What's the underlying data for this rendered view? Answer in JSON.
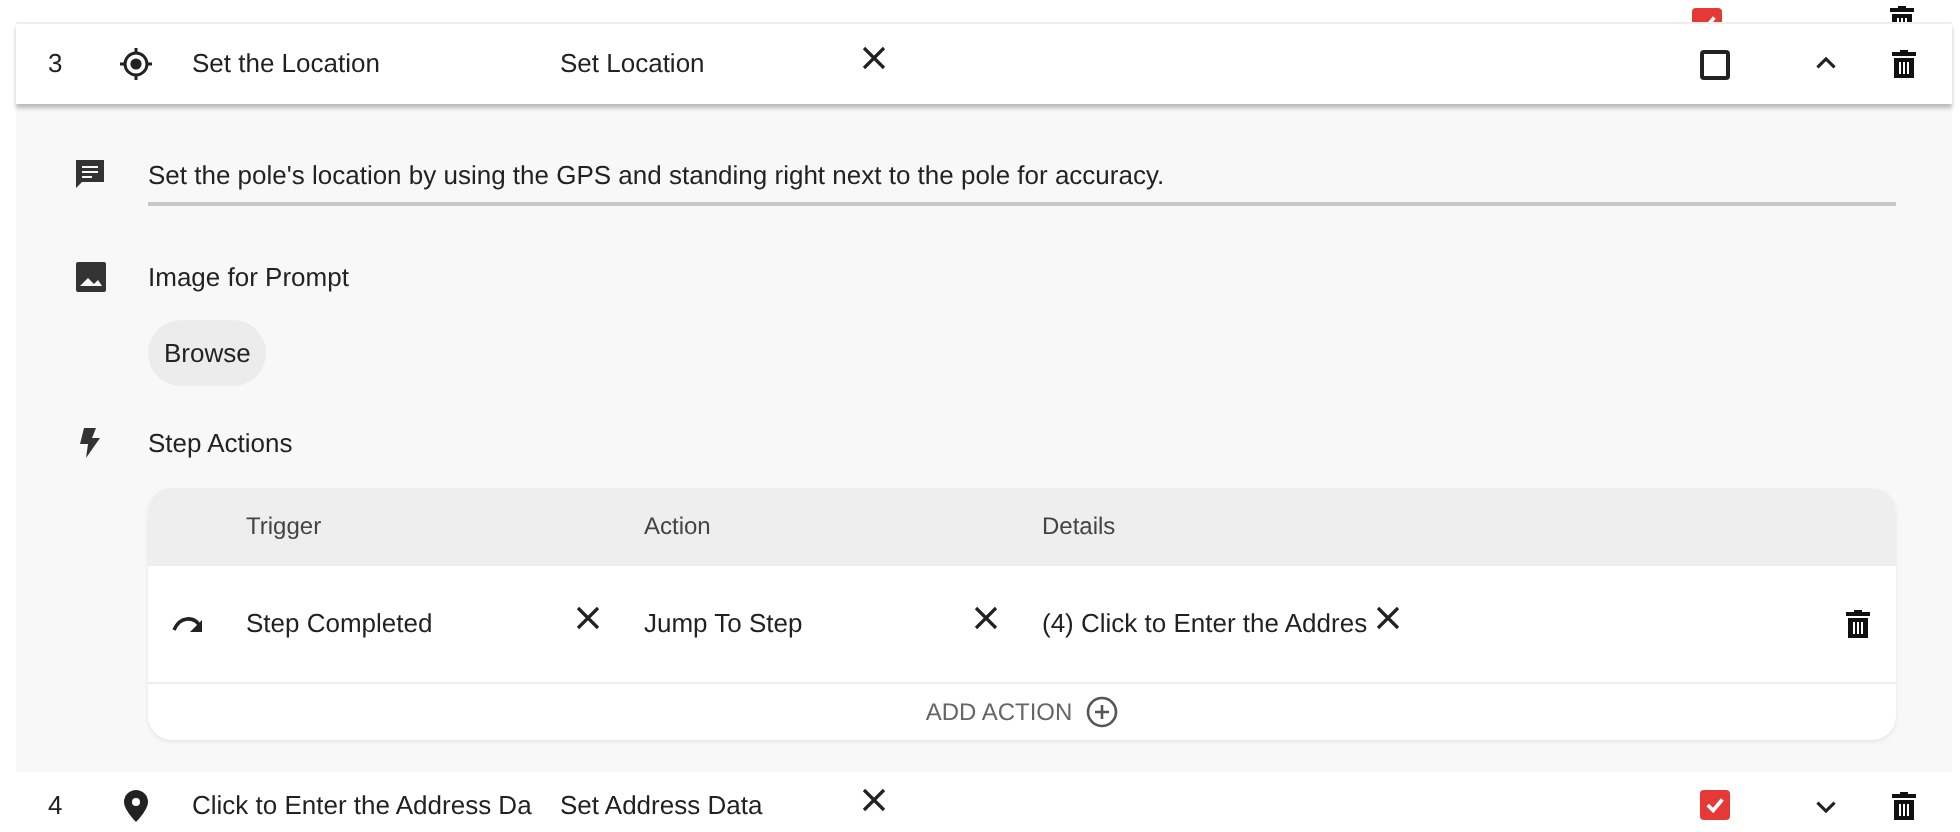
{
  "steps": [
    {
      "checked": true
    },
    {
      "number": "3",
      "name": "Set the Location",
      "type": "Set Location",
      "checked": false,
      "expanded": true,
      "kind": "location",
      "detail": {
        "prompt": "Set the pole's location by using the GPS and standing right next to the pole for accuracy.",
        "image_label": "Image for Prompt",
        "browse": "Browse",
        "actions_label": "Step Actions",
        "columns": [
          "Trigger",
          "Action",
          "Details"
        ],
        "actions": [
          {
            "trigger": "Step Completed",
            "action": "Jump To Step",
            "details": "(4) Click to Enter the Addres"
          }
        ],
        "add_action": "ADD ACTION"
      }
    },
    {
      "number": "4",
      "name": "Click to Enter the Address Da",
      "type": "Set Address Data",
      "checked": true,
      "expanded": false,
      "kind": "address"
    }
  ]
}
